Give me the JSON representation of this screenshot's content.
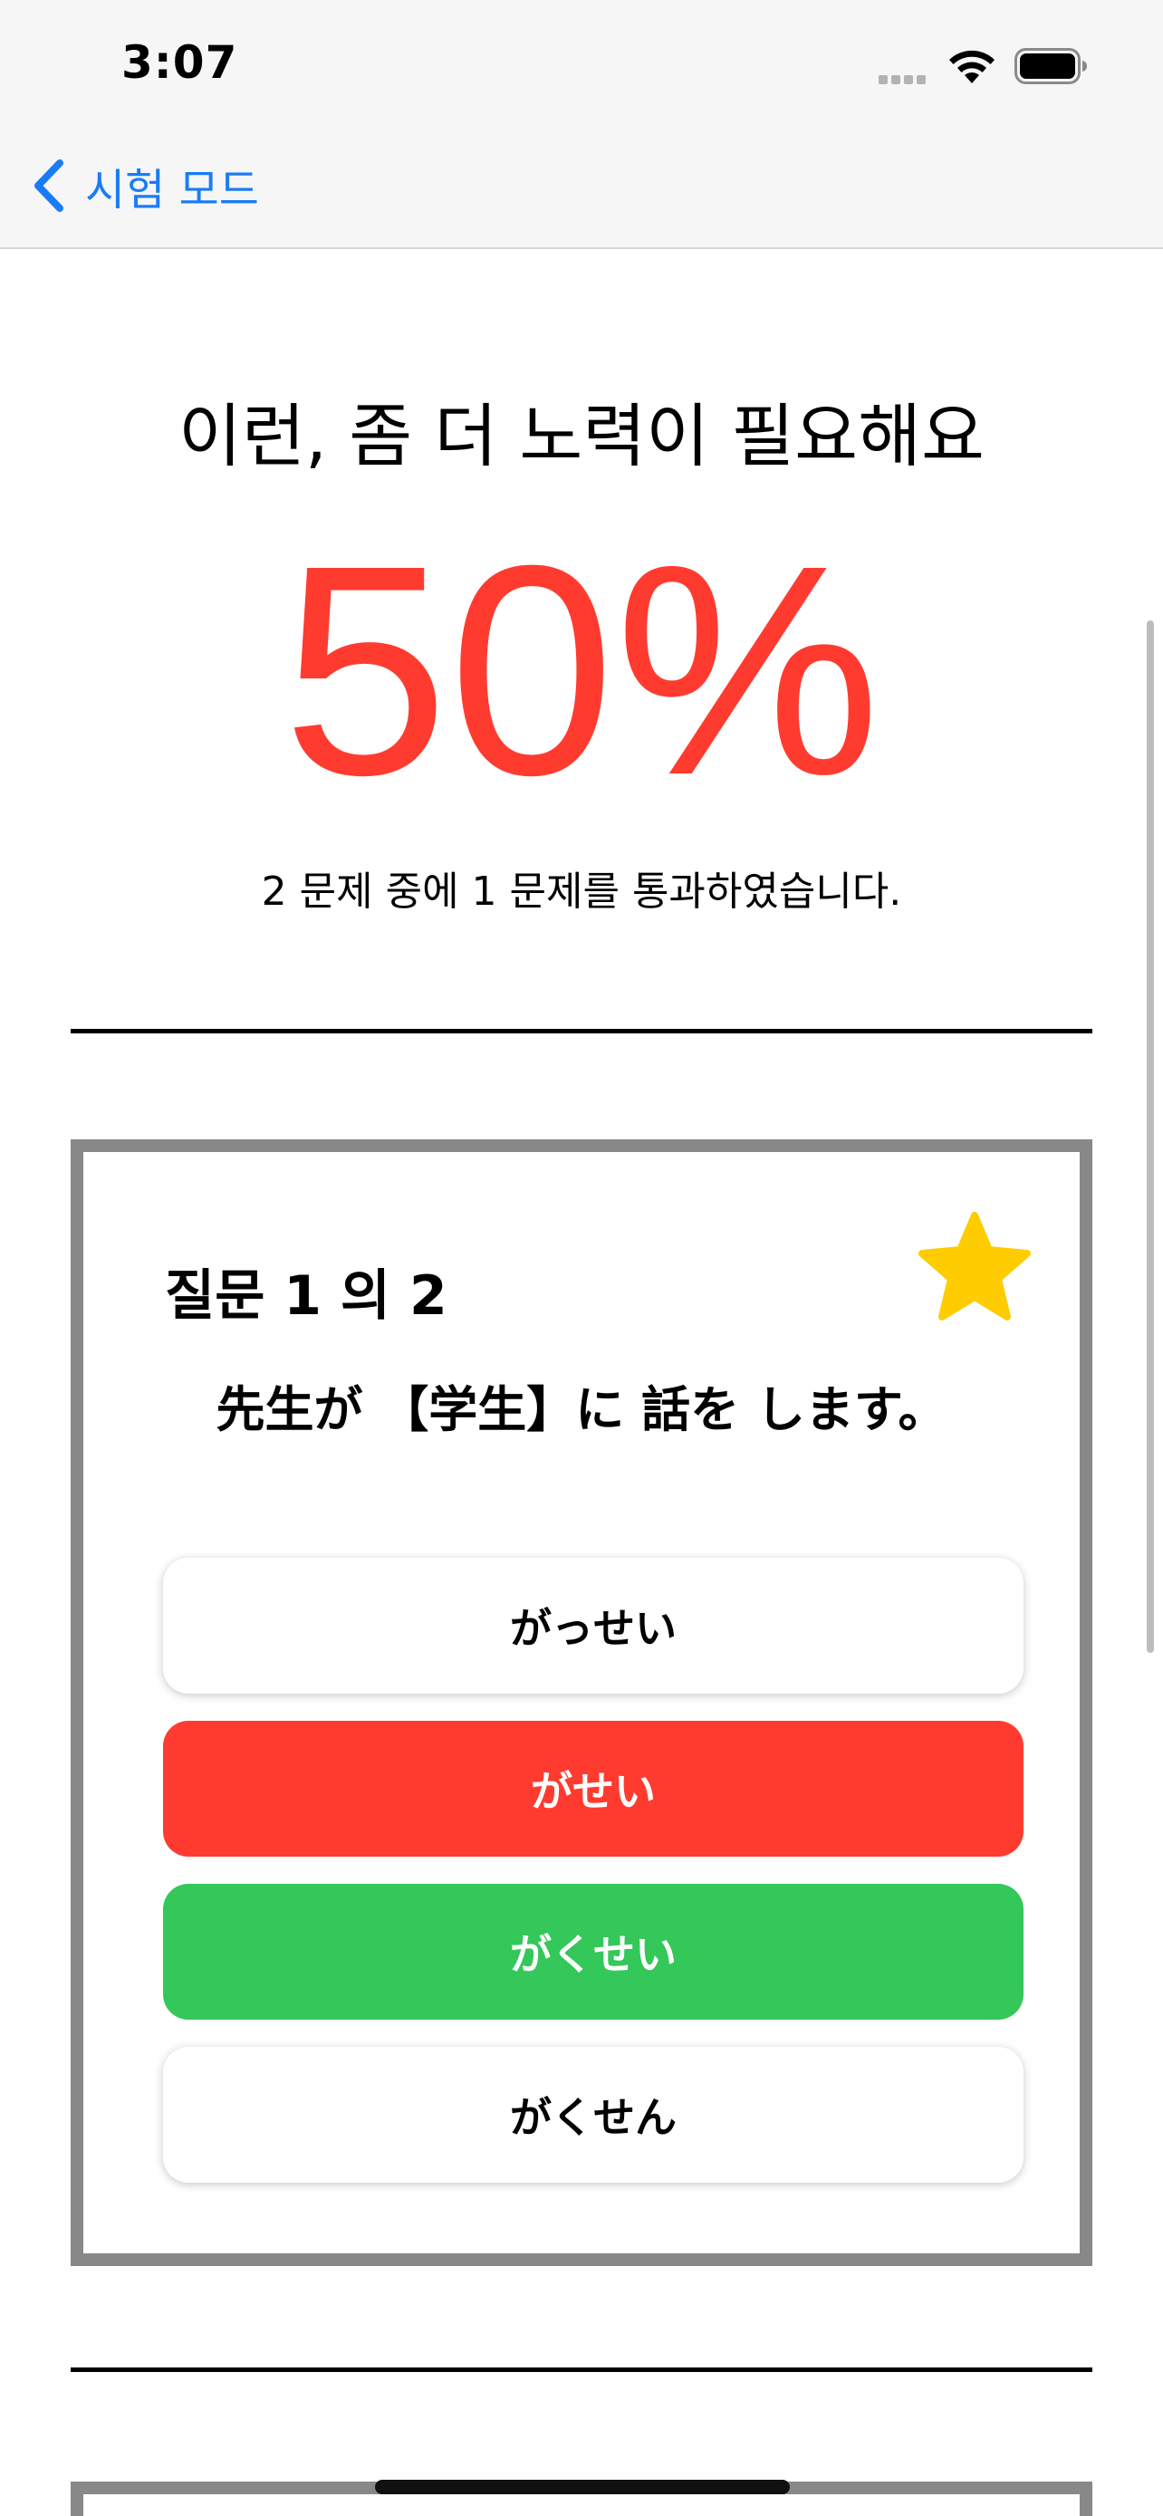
{
  "status_bar": {
    "time": "3:07"
  },
  "nav": {
    "back_label": "시험 모드"
  },
  "result": {
    "title": "이런, 좀 더 노력이 필요해요",
    "percent": "50%",
    "summary": "2 문제 중에 1 문제를 통과하였습니다."
  },
  "colors": {
    "accent_blue": "#1a7cf5",
    "score_red": "#ff3b30",
    "correct_green": "#34c759",
    "star_yellow": "#ffcc00",
    "card_border": "#888888"
  },
  "question": {
    "header": "질문 1 의 2",
    "text": "先生が 【学生】に 話を します。",
    "starred": true,
    "options": [
      {
        "label": "がっせい",
        "state": "default"
      },
      {
        "label": "がせい",
        "state": "wrong-selected"
      },
      {
        "label": "がくせい",
        "state": "correct"
      },
      {
        "label": "がくせん",
        "state": "default"
      }
    ]
  }
}
